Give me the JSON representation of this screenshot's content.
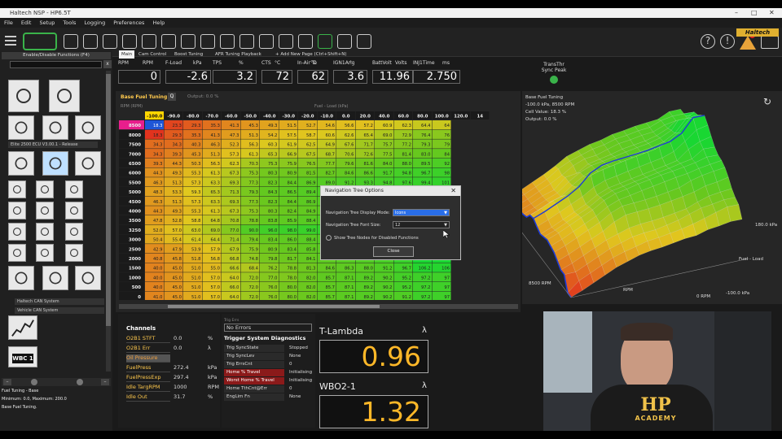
{
  "window": {
    "title": "Haltech NSP - HP6.5T"
  },
  "menu": [
    "File",
    "Edit",
    "Setup",
    "Tools",
    "Logging",
    "Preferences",
    "Help"
  ],
  "brand": {
    "logo": "Haltech",
    "accent": "#ffc94d"
  },
  "left_panel": {
    "header": "Enable/Disable Functions (F4)",
    "search_placeholder": "",
    "close_label": "x",
    "items": [
      {
        "label": "Elite 2500 ECU V3.00.1 - Release"
      },
      {
        "label": "Haltech CAN System"
      },
      {
        "label": "Vehicle CAN System"
      },
      {
        "label": "WBC 1"
      }
    ],
    "info_title": "Fuel Tuning - Base",
    "info_range": "Minimum: 0.0, Maximum: 200.0",
    "info_desc": "Base Fuel Tuning."
  },
  "tabs": [
    "Main",
    "Cam Control",
    "Boost Tuning",
    "AFR Tuning Playback",
    "+ Add New Page (Ctrl+Shift+N)"
  ],
  "gauges": [
    {
      "name": "RPM",
      "unit": "RPM",
      "value": "0"
    },
    {
      "name": "F-Load",
      "unit": "kPa",
      "value": "-2.6"
    },
    {
      "name": "TPS",
      "unit": "%",
      "value": "3.2"
    },
    {
      "name": "CTS",
      "unit": "°C",
      "value": "72"
    },
    {
      "name": "In-Air Te",
      "unit": "°C",
      "value": "62"
    },
    {
      "name": "IGN1Ang",
      "unit": "°",
      "value": "3.6"
    },
    {
      "name": "BattVolt",
      "unit": "Volts",
      "value": "11.96"
    },
    {
      "name": "INJ1Time",
      "unit": "ms",
      "value": "2.750"
    }
  ],
  "trans_sync": {
    "label1": "TransThr",
    "label2": "Sync Peak"
  },
  "table": {
    "title": "Base Fuel Tuning",
    "q": "Q",
    "output": "Output: 0.0 %",
    "rpm_axis": "RPM (RPM)",
    "load_axis": "Fuel - Load (kPa)",
    "cols": [
      "-100.0",
      "-90.0",
      "-80.0",
      "-70.0",
      "-60.0",
      "-50.0",
      "-40.0",
      "-30.0",
      "-20.0",
      "-10.0",
      "0.0",
      "20.0",
      "40.0",
      "60.0",
      "80.0",
      "100.0",
      "120.0",
      "14"
    ],
    "rows": [
      "8500",
      "8000",
      "7500",
      "7000",
      "6500",
      "6000",
      "5500",
      "5000",
      "4500",
      "4000",
      "3500",
      "3250",
      "3000",
      "2500",
      "2000",
      "1500",
      "1000",
      "500",
      "0"
    ],
    "cells": [
      [
        "18.3",
        "23.3",
        "29.3",
        "35.3",
        "41.3",
        "45.3",
        "49.3",
        "51.5",
        "52.7",
        "54.6",
        "56.6",
        "57.2",
        "60.9",
        "62.3",
        "64.4",
        "64"
      ],
      [
        "18.3",
        "29.3",
        "35.3",
        "41.3",
        "47.3",
        "51.3",
        "54.2",
        "57.5",
        "58.7",
        "60.6",
        "62.6",
        "65.4",
        "69.0",
        "72.9",
        "76.4",
        "76"
      ],
      [
        "34.3",
        "34.3",
        "40.3",
        "46.3",
        "52.3",
        "56.3",
        "60.3",
        "61.9",
        "62.5",
        "64.9",
        "67.6",
        "71.7",
        "75.7",
        "77.2",
        "79.3",
        "79"
      ],
      [
        "34.3",
        "39.3",
        "45.3",
        "51.3",
        "57.3",
        "61.3",
        "65.3",
        "66.9",
        "67.5",
        "68.7",
        "70.6",
        "72.6",
        "77.5",
        "81.4",
        "83.0",
        "84"
      ],
      [
        "39.3",
        "44.3",
        "50.3",
        "56.3",
        "62.3",
        "70.3",
        "75.3",
        "75.9",
        "76.5",
        "77.7",
        "79.6",
        "81.6",
        "84.0",
        "88.0",
        "89.5",
        "92"
      ],
      [
        "44.3",
        "49.3",
        "55.3",
        "61.3",
        "67.3",
        "75.3",
        "80.3",
        "80.9",
        "81.5",
        "82.7",
        "84.6",
        "86.6",
        "91.7",
        "94.8",
        "96.7",
        "98"
      ],
      [
        "46.3",
        "51.3",
        "57.3",
        "63.3",
        "69.3",
        "77.3",
        "82.3",
        "84.4",
        "86.9",
        "89.0",
        "91.2",
        "93.3",
        "94.8",
        "97.6",
        "99.4",
        "101"
      ],
      [
        "48.3",
        "53.3",
        "59.3",
        "65.3",
        "71.3",
        "79.3",
        "84.3",
        "86.5",
        "89.4",
        "91.5",
        "93.7",
        "95.2",
        "97.0",
        "99.2",
        "102.6",
        "102"
      ],
      [
        "46.3",
        "51.3",
        "57.3",
        "63.3",
        "69.3",
        "77.3",
        "82.3",
        "84.4",
        "86.9",
        "89.0",
        "91.2",
        "93.3",
        "96.0",
        "98.2",
        "106.8",
        "106"
      ],
      [
        "44.3",
        "49.3",
        "55.3",
        "61.3",
        "67.3",
        "75.3",
        "80.3",
        "82.4",
        "84.9",
        "87.0",
        "89.2",
        "91.3",
        "94.0",
        "104.2",
        "110.3",
        "113"
      ],
      [
        "47.8",
        "52.8",
        "58.8",
        "64.8",
        "70.8",
        "78.8",
        "83.8",
        "85.9",
        "88.4",
        "90.5",
        "92.7",
        "94.8",
        "99.2",
        "108.2",
        "118.5",
        "121"
      ],
      [
        "52.0",
        "57.0",
        "63.0",
        "69.0",
        "77.0",
        "90.0",
        "96.0",
        "98.0",
        "99.0",
        "100.0",
        "101.2",
        "103.4",
        "105.6",
        "112.2",
        "127.5",
        "127"
      ],
      [
        "50.4",
        "55.4",
        "61.4",
        "64.4",
        "71.4",
        "79.4",
        "83.4",
        "86.0",
        "88.4",
        "90.4",
        "92.4",
        "94.4",
        "98.8",
        "107.6",
        "121.0",
        "122"
      ],
      [
        "42.9",
        "47.9",
        "53.9",
        "57.9",
        "67.9",
        "75.9",
        "80.9",
        "83.4",
        "85.8",
        "87.3",
        "89.3",
        "91.3",
        "94.6",
        "101.8",
        "115.8",
        "117"
      ],
      [
        "40.8",
        "45.8",
        "51.8",
        "56.8",
        "66.8",
        "74.8",
        "79.8",
        "81.7",
        "84.1",
        "86.5",
        "88.6",
        "90.5",
        "93.8",
        "99.7",
        "115.9",
        "115"
      ],
      [
        "40.0",
        "45.0",
        "51.0",
        "55.0",
        "66.6",
        "68.4",
        "76.2",
        "78.8",
        "81.3",
        "84.6",
        "86.3",
        "88.0",
        "91.2",
        "96.7",
        "106.2",
        "106"
      ],
      [
        "40.0",
        "45.0",
        "51.0",
        "57.0",
        "64.0",
        "72.0",
        "77.0",
        "78.0",
        "82.0",
        "85.7",
        "87.1",
        "89.2",
        "90.2",
        "95.2",
        "97.2",
        "97"
      ],
      [
        "40.0",
        "45.0",
        "51.0",
        "57.0",
        "66.0",
        "72.0",
        "76.0",
        "80.0",
        "82.0",
        "85.7",
        "87.1",
        "89.2",
        "90.2",
        "95.2",
        "97.2",
        "97"
      ],
      [
        "41.0",
        "45.0",
        "51.0",
        "57.0",
        "64.0",
        "72.0",
        "76.0",
        "80.0",
        "82.0",
        "85.7",
        "87.1",
        "89.2",
        "90.2",
        "91.2",
        "97.2",
        "97"
      ]
    ]
  },
  "dialog": {
    "title": "Navigation Tree Options",
    "mode_label": "Navigation Tree Display Mode:",
    "mode_value": "Icons",
    "size_label": "Navigation Tree Font Size:",
    "size_value": "12",
    "checkbox_label": "Show Tree Nodes for Disabled Functions",
    "close_button": "Close"
  },
  "plot": {
    "title": "Base Fuel Tuning",
    "line1": "-100.0 kPa, 8500 RPM",
    "line2": "Cell Value: 18.3 %",
    "line3": "Output: 0.0 %",
    "ax_rpm_hi": "8500 RPM",
    "ax_rpm": "RPM",
    "ax_rpm_lo": "0 RPM",
    "ax_load_hi": "180.0 kPa",
    "ax_load": "Fuel - Load",
    "ax_load_lo": "-100.0 kPa"
  },
  "channels": {
    "title": "Channels",
    "rows": [
      {
        "name": "O2B1 STFT",
        "value": "0.0",
        "unit": "%"
      },
      {
        "name": "O2B1 Err",
        "value": "0.0",
        "unit": "λ"
      },
      {
        "name": "Oil Pressure",
        "value": "",
        "unit": ""
      },
      {
        "name": "FuelPress",
        "value": "272.4",
        "unit": "kPa"
      },
      {
        "name": "FuelPressExp",
        "value": "297.4",
        "unit": "kPa"
      },
      {
        "name": "Idle TargRPM",
        "value": "1000",
        "unit": "RPM"
      },
      {
        "name": "Idle Out",
        "value": "31.7",
        "unit": "%"
      }
    ]
  },
  "trigger": {
    "err_label": "Trig Errs",
    "err_value": "No Errors",
    "title": "Trigger System Diagnostics",
    "rows": [
      {
        "name": "Trig SyncState",
        "value": "Stopped",
        "alert": false
      },
      {
        "name": "Trig SyncLev",
        "value": "None",
        "alert": false
      },
      {
        "name": "Trig ErrsCnt",
        "value": "0",
        "alert": false
      },
      {
        "name": "Home % Travel",
        "value": "Initialising",
        "alert": true
      },
      {
        "name": "Worst Home % Travel",
        "value": "Initialising",
        "alert": true
      },
      {
        "name": "Home TthCnt@Err",
        "value": "0",
        "alert": false
      },
      {
        "name": "EngLim Fn",
        "value": "None",
        "alert": false
      }
    ]
  },
  "lambda": {
    "t_label": "T-Lambda",
    "t_symbol": "λ",
    "t_value": "0.96",
    "w_label": "WBO2-1",
    "w_symbol": "λ",
    "w_value": "1.32"
  },
  "video": {
    "shirt_text1": "HP",
    "shirt_text2": "ACADEMY"
  }
}
